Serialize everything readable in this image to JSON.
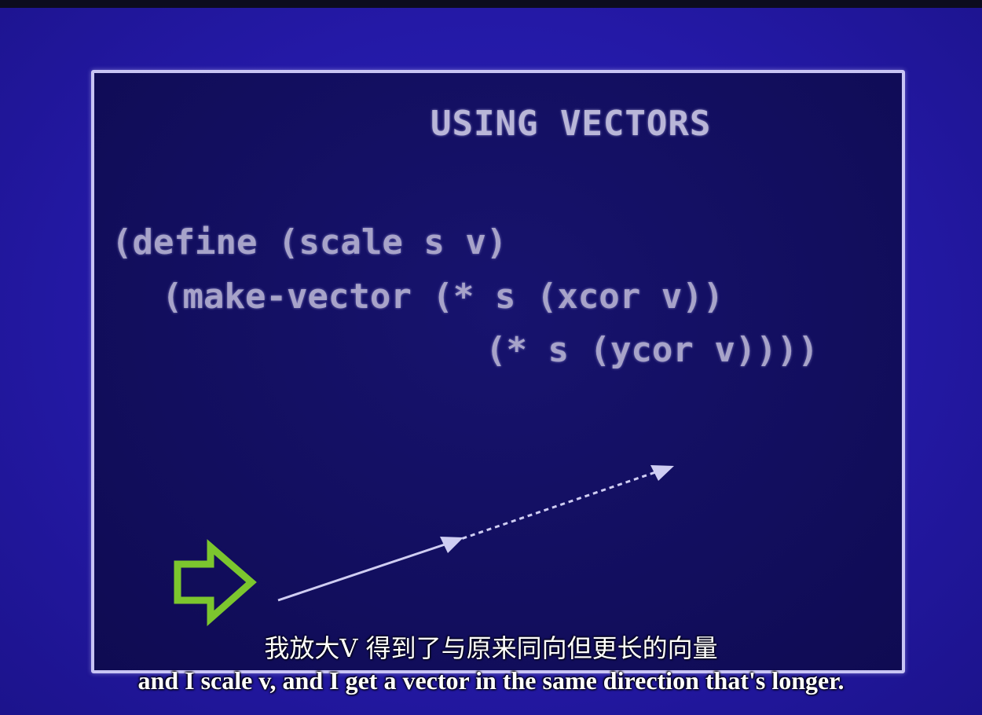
{
  "slide": {
    "title": "USING VECTORS",
    "code": [
      "(define (scale s v)",
      "(make-vector (* s (xcor v))",
      "(* s (ycor v))))"
    ]
  },
  "drawing": {
    "pointer_icon": "hollow-right-arrow-icon",
    "pointer_color": "#7cc62e",
    "vector_color": "#cfcdf2"
  },
  "subtitles": {
    "zh": "我放大V 得到了与原来同向但更长的向量",
    "en": "and I scale v, and I get a vector in the same direction that's longer."
  }
}
